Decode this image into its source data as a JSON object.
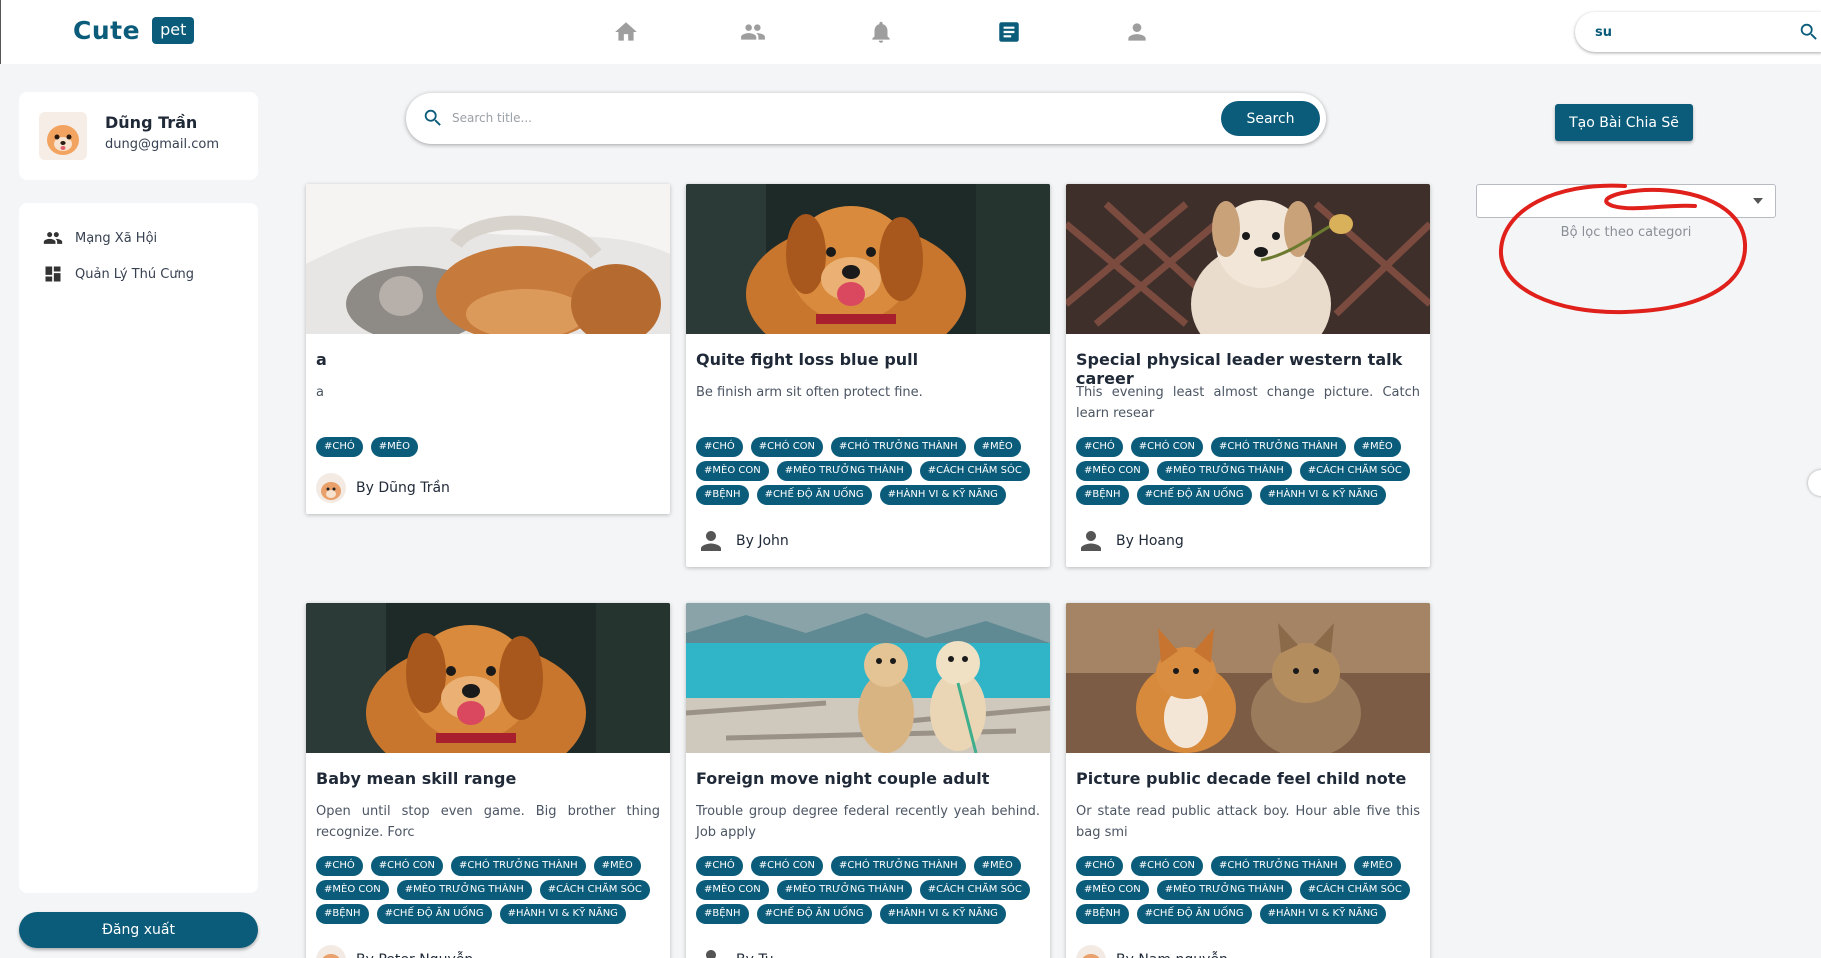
{
  "topbar": {
    "logo_text": "Cute",
    "logo_badge": "pet",
    "nav_icons": [
      "home-icon",
      "people-icon",
      "bell-icon",
      "article-icon",
      "person-icon"
    ],
    "search_value": "su"
  },
  "sidebar": {
    "profile": {
      "name": "Dũng Trần",
      "email": "dung@gmail.com"
    },
    "items": [
      {
        "label": "Mạng Xã Hội",
        "icon": "people-icon"
      },
      {
        "label": "Quản Lý Thú Cưng",
        "icon": "dashboard-icon"
      }
    ],
    "logout_label": "Đăng xuất"
  },
  "search": {
    "placeholder": "Search title...",
    "button_label": "Search"
  },
  "right": {
    "create_label": "Tạo Bài Chia Sẽ",
    "category_select_value": "",
    "category_hint": "Bộ lọc theo categori"
  },
  "colors": {
    "primary": "#0b5c7a",
    "annotation": "#e0201b"
  },
  "posts": [
    {
      "title": "a",
      "desc": "a",
      "tags": [
        "#CHÓ",
        "#MÈO"
      ],
      "author": "By Dũng Trần",
      "image": "puppy-and-kitten-sleeping",
      "avatar": "profile-photo"
    },
    {
      "title": "Quite fight loss blue pull",
      "desc": "Be finish arm sit often protect fine.",
      "tags": [
        "#CHÓ",
        "#CHÓ CON",
        "#CHÓ TRƯỞNG THÀNH",
        "#MÈO",
        "#MÈO CON",
        "#MÈO TRƯỞNG THÀNH",
        "#CÁCH CHĂM SÓC",
        "#BỆNH",
        "#CHẾ ĐỘ ĂN UỐNG",
        "#HÀNH VI & KỸ NĂNG"
      ],
      "author": "By John",
      "image": "golden-retriever",
      "avatar": "default-person"
    },
    {
      "title": "Special physical leader western talk career",
      "desc": "This evening least almost change picture. Catch learn resear",
      "tags": [
        "#CHÓ",
        "#CHÓ CON",
        "#CHÓ TRƯỞNG THÀNH",
        "#MÈO",
        "#MÈO CON",
        "#MÈO TRƯỞNG THÀNH",
        "#CÁCH CHĂM SÓC",
        "#BỆNH",
        "#CHẾ ĐỘ ĂN UỐNG",
        "#HÀNH VI & KỸ NĂNG"
      ],
      "author": "By Hoang",
      "image": "dog-with-flower",
      "avatar": "default-person"
    },
    {
      "title": "Baby mean skill range",
      "desc": "Open until stop even game. Big brother thing recognize. Forc",
      "tags": [
        "#CHÓ",
        "#CHÓ CON",
        "#CHÓ TRƯỞNG THÀNH",
        "#MÈO",
        "#MÈO CON",
        "#MÈO TRƯỞNG THÀNH",
        "#CÁCH CHĂM SÓC",
        "#BỆNH",
        "#CHẾ ĐỘ ĂN UỐNG",
        "#HÀNH VI & KỸ NĂNG"
      ],
      "author": "By Peter Nguyễn",
      "image": "golden-retriever",
      "avatar": "profile-photo"
    },
    {
      "title": "Foreign move night couple adult",
      "desc": "Trouble group degree federal recently yeah behind. Job apply",
      "tags": [
        "#CHÓ",
        "#CHÓ CON",
        "#CHÓ TRƯỞNG THÀNH",
        "#MÈO",
        "#MÈO CON",
        "#MÈO TRƯỞNG THÀNH",
        "#CÁCH CHĂM SÓC",
        "#BỆNH",
        "#CHẾ ĐỘ ĂN UỐNG",
        "#HÀNH VI & KỸ NĂNG"
      ],
      "author": "By Tu",
      "image": "two-dogs-by-lake",
      "avatar": "default-person"
    },
    {
      "title": "Picture public decade feel child note",
      "desc": "Or state read public attack boy. Hour able five this bag smi",
      "tags": [
        "#CHÓ",
        "#CHÓ CON",
        "#CHÓ TRƯỞNG THÀNH",
        "#MÈO",
        "#MÈO CON",
        "#MÈO TRƯỞNG THÀNH",
        "#CÁCH CHĂM SÓC",
        "#BỆNH",
        "#CHẾ ĐỘ ĂN UỐNG",
        "#HÀNH VI & KỸ NĂNG"
      ],
      "author": "By Nam nguyễn",
      "image": "corgi-and-yorkie",
      "avatar": "profile-photo"
    }
  ]
}
